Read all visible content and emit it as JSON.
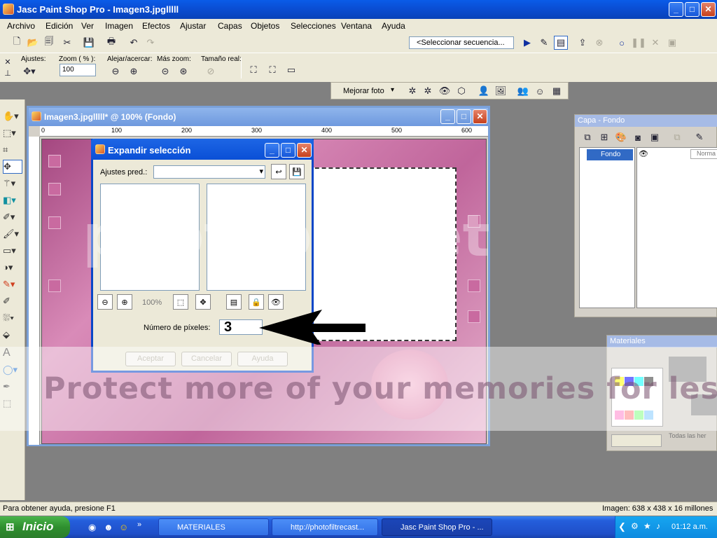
{
  "app": {
    "title": "Jasc Paint Shop Pro - Imagen3.jpglllll",
    "window_buttons": [
      "_",
      "□",
      "✕"
    ]
  },
  "menu": [
    "Archivo",
    "Edición",
    "Ver",
    "Imagen",
    "Efectos",
    "Ajustar",
    "Capas",
    "Objetos",
    "Selecciones",
    "Ventana",
    "Ayuda"
  ],
  "script_toolbar": {
    "sequence_select": "<Seleccionar secuencia..."
  },
  "tool_options": {
    "ajustes_label": "Ajustes:",
    "zoom_label": "Zoom ( % ):",
    "zoom_value": "100",
    "alejar_label": "Alejar/acercar:",
    "mas_zoom_label": "Más zoom:",
    "tamano_label": "Tamaño real:"
  },
  "photo_toolbar": {
    "mejorar_foto": "Mejorar foto"
  },
  "image_window": {
    "title": "Imagen3.jpglllll* @ 100% (Fondo)",
    "ruler_labels": [
      "0",
      "100",
      "200",
      "300",
      "400",
      "500",
      "600"
    ]
  },
  "dialog": {
    "title": "Expandir selección",
    "presets_label": "Ajustes pred.:",
    "zoom_percent": "100%",
    "pixels_label": "Número de píxeles:",
    "pixels_value": "3",
    "ok": "Aceptar",
    "cancel": "Cancelar",
    "help": "Ayuda"
  },
  "layers_palette": {
    "title": "Capa - Fondo",
    "layer_name": "Fondo",
    "blend": "Norma"
  },
  "materials_palette": {
    "title": "Materiales",
    "all_layers": "Todas las her"
  },
  "watermark": {
    "brand": "photobucket",
    "tagline": "Protect more of your memories for less!"
  },
  "status": {
    "help": "Para obtener ayuda, presione F1",
    "image_info": "Imagen:  638 x 438 x 16 millones"
  },
  "taskbar": {
    "start": "Inicio",
    "items": [
      "MATERIALES",
      "http://photofiltrecast...",
      "Jasc Paint Shop Pro - ..."
    ],
    "clock": "01:12 a.m."
  },
  "colors": {
    "xp_blue": "#0a4fd6",
    "canvas_pink": "#c0659b",
    "workspace_gray": "#808080"
  }
}
